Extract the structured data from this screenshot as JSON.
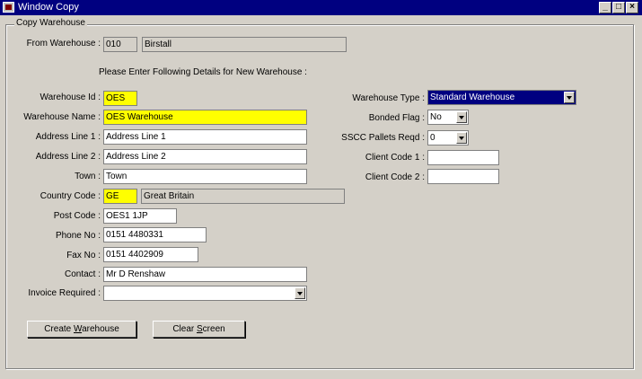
{
  "window": {
    "title": "Window Copy",
    "min_label": "_",
    "max_label": "□",
    "close_label": "×"
  },
  "frame_title": "Copy Warehouse",
  "from": {
    "label": "From Warehouse :",
    "code": "010",
    "name": "Birstall"
  },
  "instruction": "Please Enter Following Details for New Warehouse :",
  "left_fields": {
    "warehouse_id": {
      "label": "Warehouse Id :",
      "value": "OES"
    },
    "warehouse_name": {
      "label": "Warehouse Name :",
      "value": "OES Warehouse"
    },
    "address1": {
      "label": "Address Line 1 :",
      "value": "Address Line 1"
    },
    "address2": {
      "label": "Address Line 2 :",
      "value": "Address Line 2"
    },
    "town": {
      "label": "Town :",
      "value": "Town"
    },
    "country": {
      "label": "Country Code :",
      "code": "GE",
      "name": "Great Britain"
    },
    "post_code": {
      "label": "Post Code :",
      "value": "OES1 1JP"
    },
    "phone": {
      "label": "Phone No :",
      "value": "0151 4480331"
    },
    "fax": {
      "label": "Fax No :",
      "value": "0151 4402909"
    },
    "contact": {
      "label": "Contact :",
      "value": "Mr D Renshaw"
    },
    "invoice": {
      "label": "Invoice Required :",
      "value": ""
    }
  },
  "right_fields": {
    "warehouse_type": {
      "label": "Warehouse Type :",
      "value": "Standard Warehouse"
    },
    "bonded": {
      "label": "Bonded Flag :",
      "value": "No"
    },
    "sscc": {
      "label": "SSCC Pallets Reqd :",
      "value": "0"
    },
    "client1": {
      "label": "Client Code 1 :",
      "value": ""
    },
    "client2": {
      "label": "Client Code 2 :",
      "value": ""
    }
  },
  "buttons": {
    "create_pre": "Create ",
    "create_ul": "W",
    "create_post": "arehouse",
    "clear_pre": "Clear ",
    "clear_ul": "S",
    "clear_post": "creen"
  }
}
